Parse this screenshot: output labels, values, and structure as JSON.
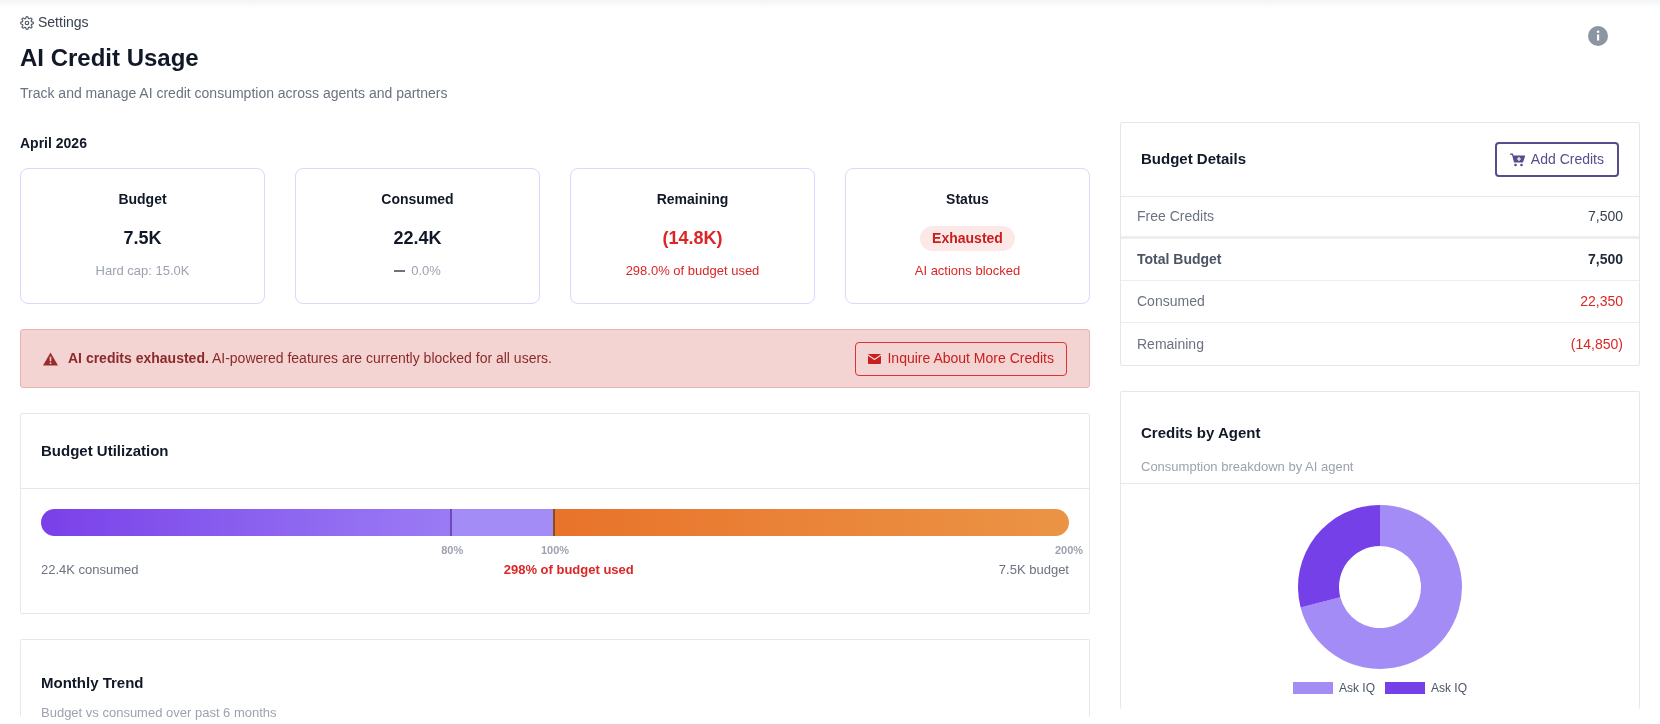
{
  "breadcrumb": "Settings",
  "header": {
    "title": "AI Credit Usage",
    "subtitle": "Track and manage AI credit consumption across agents and partners"
  },
  "period": "April 2026",
  "stats": [
    {
      "kind": "value",
      "label": "Budget",
      "value": "7.5K",
      "note": "Hard cap: 15.0K",
      "alert": false
    },
    {
      "kind": "trend",
      "label": "Consumed",
      "value": "22.4K",
      "note": "0.0%",
      "alert": false
    },
    {
      "kind": "value",
      "label": "Remaining",
      "value": "(14.8K)",
      "note": "298.0% of budget used",
      "alert": true
    },
    {
      "kind": "badge",
      "label": "Status",
      "value": "Exhausted",
      "note": "AI actions blocked",
      "alert": true
    }
  ],
  "alert": {
    "message": "**AI credits exhausted.** AI-powered features are currently blocked for all users.",
    "button": "Inquire About More Credits"
  },
  "utilization": {
    "title": "Budget Utilization",
    "ticks": [
      "80%",
      "100%",
      "200%"
    ],
    "consumed": "22.4K consumed",
    "used": "298% of budget used",
    "budget": "7.5K budget"
  },
  "trend": {
    "title": "Monthly Trend",
    "subtitle": "Budget vs consumed over past 6 months"
  },
  "budget_details": {
    "title": "Budget Details",
    "button": "Add Credits",
    "rows": [
      {
        "kind": "plain",
        "label": "Free Credits",
        "value": "7,500"
      },
      {
        "kind": "total",
        "label": "Total Budget",
        "value": "7,500"
      },
      {
        "kind": "negative",
        "label": "Consumed",
        "value": "22,350"
      },
      {
        "kind": "negative",
        "label": "Remaining",
        "value": "(14,850)"
      }
    ]
  },
  "agents": {
    "title": "Credits by Agent",
    "subtitle": "Consumption breakdown by AI agent",
    "legend": [
      {
        "label": "Ask IQ",
        "color": "#a48cf6"
      },
      {
        "label": "Ask IQ",
        "color": "#7640e8"
      }
    ]
  }
}
